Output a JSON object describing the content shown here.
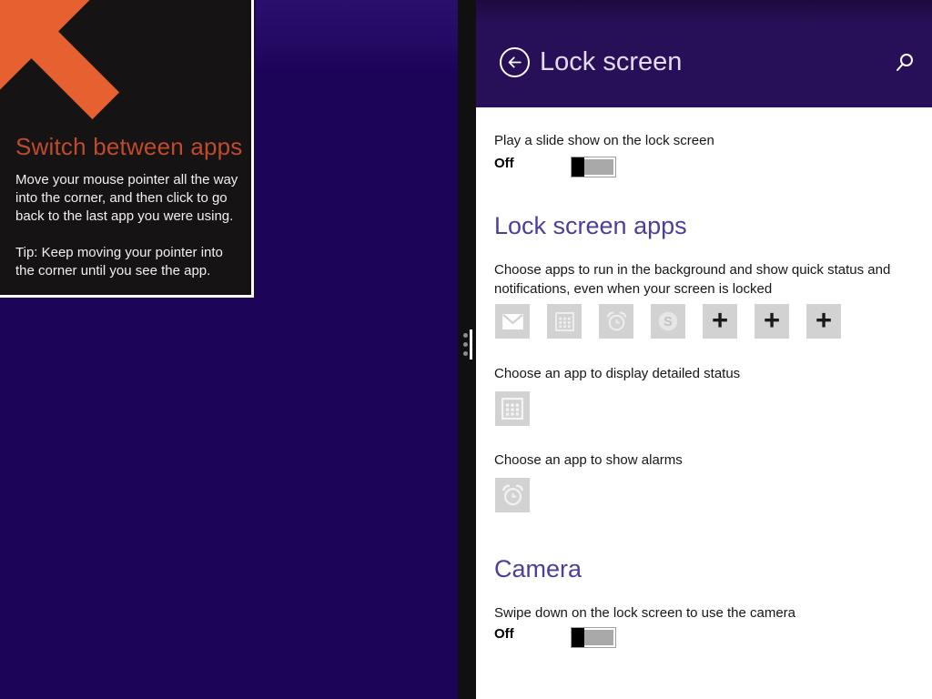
{
  "tip_panel": {
    "title": "Switch between apps",
    "body_main": "Move your mouse pointer all the way into the corner, and then click to go back to the last app you were using.",
    "body_tip": "Tip: Keep moving your pointer into the corner until you see the app.",
    "accent_color": "#bf4b2d",
    "arrow_color": "#e7602f"
  },
  "settings_page": {
    "header": {
      "title": "Lock screen",
      "back_icon": "arrow-left-circle",
      "search_icon": "magnifying-glass",
      "background_color": "#271057"
    },
    "slideshow": {
      "label": "Play a slide show on the lock screen",
      "state": "Off"
    },
    "lock_screen_apps": {
      "heading": "Lock screen apps",
      "description": "Choose apps to run in the background and show quick status and notifications, even when your screen is locked",
      "add_label": "+",
      "app_slots": [
        "mail",
        "calendar",
        "alarm-clock",
        "skype",
        "add",
        "add",
        "add"
      ],
      "detailed_status": {
        "label": "Choose an app to display detailed status",
        "app_icon": "calendar"
      },
      "alarms": {
        "label": "Choose an app to show alarms",
        "app_icon": "alarm-clock"
      }
    },
    "camera": {
      "heading": "Camera",
      "label": "Swipe down on the lock screen to use the camera",
      "state": "Off"
    },
    "colors": {
      "heading_purple": "#4c3f9c",
      "tile_gray": "#d2d2d2",
      "left_background": "#1c0459"
    }
  }
}
